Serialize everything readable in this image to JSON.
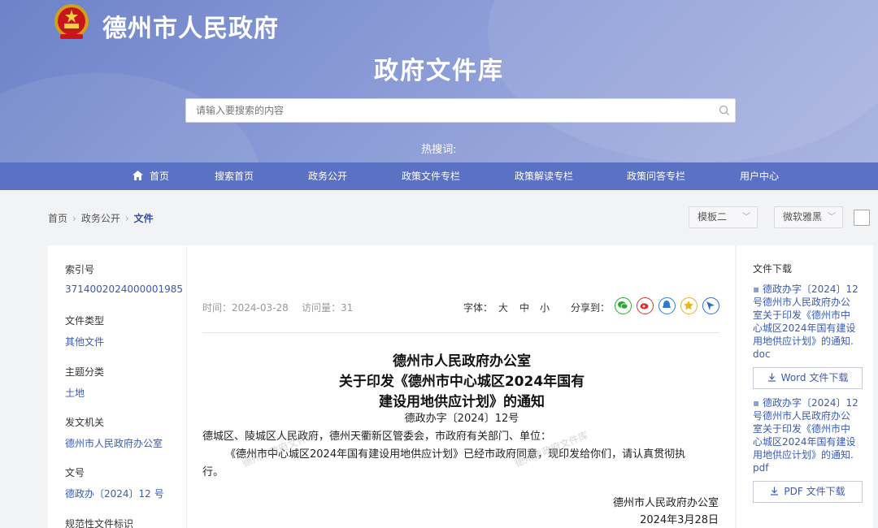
{
  "header": {
    "site_name": "德州市人民政府",
    "library_title": "政府文件库",
    "search_placeholder": "请输入要搜索的内容",
    "hot_search_label": "热搜词:"
  },
  "nav": {
    "items": [
      {
        "label": "首页"
      },
      {
        "label": "搜索首页"
      },
      {
        "label": "政务公开"
      },
      {
        "label": "政策文件专栏"
      },
      {
        "label": "政策解读专栏"
      },
      {
        "label": "政策问答专栏"
      },
      {
        "label": "用户中心"
      }
    ]
  },
  "breadcrumb": {
    "items": [
      "首页",
      "政务公开",
      "文件"
    ]
  },
  "toolbar": {
    "template_select": "模板二",
    "font_select": "微软雅黑"
  },
  "info": {
    "fields": [
      {
        "label": "索引号",
        "value": "3714002024000001985"
      },
      {
        "label": "文件类型",
        "value": "其他文件"
      },
      {
        "label": "主题分类",
        "value": "土地"
      },
      {
        "label": "发文机关",
        "value": "德州市人民政府办公室"
      },
      {
        "label": "文号",
        "value": "德政办〔2024〕12 号"
      },
      {
        "label": "规范性文件标识",
        "value": ""
      }
    ]
  },
  "article": {
    "time": "时间：2024-03-28",
    "views": "访问量：31",
    "font_label": "字体：",
    "font_large": "大",
    "font_medium": "中",
    "font_small": "小",
    "share_label": "分享到：",
    "title_line1": "德州市人民政府办公室",
    "title_line2": "关于印发《德州市中心城区2024年国有",
    "title_line3": "建设用地供应计划》的通知",
    "doc_number": "德政办字〔2024〕12号",
    "recipients": "德城区、陵城区人民政府，德州天衢新区管委会，市政府有关部门、单位：",
    "body_line1": "《德州市中心城区2024年国有建设用地供应计划》已经市政府同意，现印发给你们，请认真贯彻执",
    "body_line2": "行。",
    "signature": "德州市人民政府办公室",
    "date": "2024年3月28日",
    "watermark": "德州市政府文件库"
  },
  "downloads": {
    "title": "文件下载",
    "word_file": "德政办字〔2024〕12号德州市人民政府办公室关于印发《德州市中心城区2024年国有建设用地供应计划》的通知.doc",
    "word_button": "Word 文件下载",
    "pdf_file": "德政办字〔2024〕12号德州市人民政府办公室关于印发《德州市中心城区2024年国有建设用地供应计划》的通知.pdf",
    "pdf_button": "PDF 文件下载"
  },
  "colors": {
    "nav_bg": "#5a71c4",
    "link_blue": "#3a5bb5",
    "header_start": "#6d82c8"
  }
}
